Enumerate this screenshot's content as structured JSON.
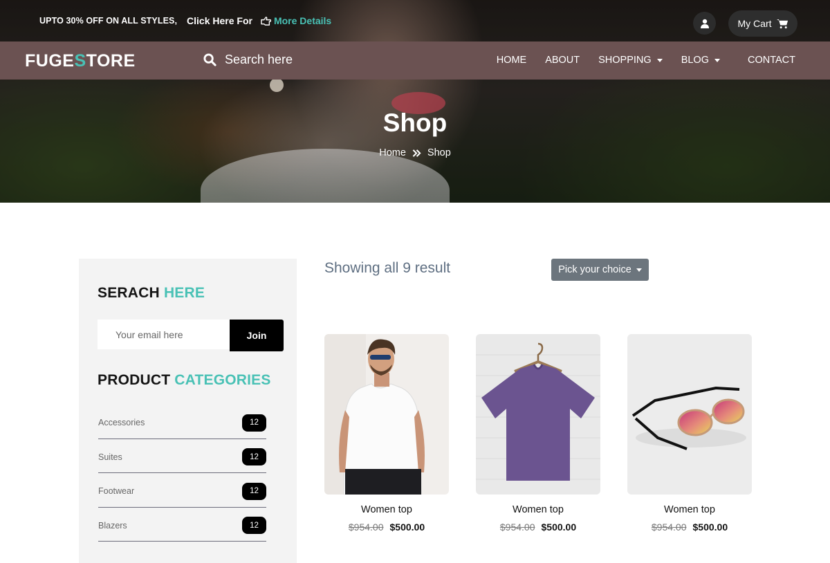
{
  "topbar": {
    "promo_offer": "UPTO 30% OFF ON ALL STYLES,",
    "promo_click": "Click Here For",
    "promo_link": "More Details",
    "cart_label": "My Cart"
  },
  "nav": {
    "logo_part1": "FUGE",
    "logo_accent": "S",
    "logo_part2": "TORE",
    "search_placeholder": "Search here",
    "items": [
      {
        "label": "HOME"
      },
      {
        "label": "ABOUT"
      },
      {
        "label": "SHOPPING"
      },
      {
        "label": "BLOG"
      },
      {
        "label": "CONTACT"
      }
    ]
  },
  "hero": {
    "title": "Shop",
    "breadcrumb": [
      "Home",
      "Shop"
    ]
  },
  "sidebar": {
    "search_heading": "SERACH",
    "search_heading_accent": "HERE",
    "email_placeholder": "Your email here",
    "join_label": "Join",
    "categories_heading": "PRODUCT",
    "categories_heading_accent": "CATEGORIES",
    "categories": [
      {
        "name": "Accessories",
        "count": "12"
      },
      {
        "name": "Suites",
        "count": "12"
      },
      {
        "name": "Footwear",
        "count": "12"
      },
      {
        "name": "Blazers",
        "count": "12"
      }
    ]
  },
  "main": {
    "result_text": "Showing all 9 result",
    "sort_label": "Pick your choice",
    "products": [
      {
        "name": "Women top",
        "old_price": "$954.00",
        "price": "$500.00"
      },
      {
        "name": "Women top",
        "old_price": "$954.00",
        "price": "$500.00"
      },
      {
        "name": "Women top",
        "old_price": "$954.00",
        "price": "$500.00"
      }
    ]
  },
  "colors": {
    "accent": "#49c1b5",
    "navbar": "#6b5252",
    "sort_button": "#6c757d"
  }
}
